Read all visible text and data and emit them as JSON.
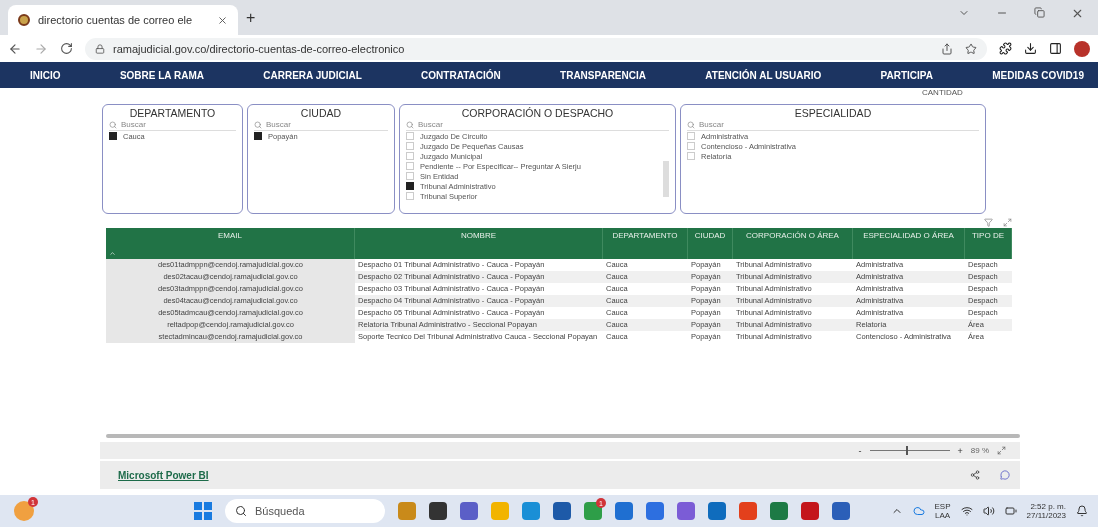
{
  "browser": {
    "tab_title": "directorio cuentas de correo ele",
    "new_tab": "+",
    "url": "ramajudicial.gov.co/directorio-cuentas-de-correo-electronico"
  },
  "nav": [
    "INICIO",
    "SOBRE LA RAMA",
    "CARRERA JUDICIAL",
    "CONTRATACIÓN",
    "TRANSPARENCIA",
    "ATENCIÓN AL USUARIO",
    "PARTICIPA",
    "MEDIDAS COVID19"
  ],
  "header_caption": "CANTIDAD",
  "slicers": [
    {
      "title": "DEPARTAMENTO",
      "placeholder": "Buscar",
      "items": [
        {
          "label": "Cauca",
          "checked": true
        }
      ]
    },
    {
      "title": "CIUDAD",
      "placeholder": "Buscar",
      "items": [
        {
          "label": "Popayán",
          "checked": true
        }
      ]
    },
    {
      "title": "CORPORACIÓN O DESPACHO",
      "placeholder": "Buscar",
      "items": [
        {
          "label": "Juzgado De Circuito",
          "checked": false
        },
        {
          "label": "Juzgado De Pequeñas Causas",
          "checked": false
        },
        {
          "label": "Juzgado Municipal",
          "checked": false
        },
        {
          "label": "Pendiente -- Por Especificar-- Preguntar A Sierju",
          "checked": false
        },
        {
          "label": "Sin Entidad",
          "checked": false
        },
        {
          "label": "Tribunal Administrativo",
          "checked": true
        },
        {
          "label": "Tribunal Superior",
          "checked": false
        }
      ]
    },
    {
      "title": "ESPECIALIDAD",
      "placeholder": "Buscar",
      "items": [
        {
          "label": "Administrativa",
          "checked": false
        },
        {
          "label": "Contencioso - Administrativa",
          "checked": false
        },
        {
          "label": "Relatoría",
          "checked": false
        }
      ]
    }
  ],
  "table": {
    "columns": [
      "EMAIL",
      "NOMBRE",
      "DEPARTAMENTO",
      "CIUDAD",
      "CORPORACIÓN O ÁREA",
      "ESPECIALIDAD O ÁREA",
      "TIPO DE"
    ],
    "rows": [
      [
        "des01tadmppn@cendoj.ramajudicial.gov.co",
        "Despacho 01 Tribunal Administrativo - Cauca - Popayán",
        "Cauca",
        "Popayán",
        "Tribunal Administrativo",
        "Administrativa",
        "Despach"
      ],
      [
        "des02tacau@cendoj.ramajudicial.gov.co",
        "Despacho 02 Tribunal Administrativo - Cauca - Popayán",
        "Cauca",
        "Popayán",
        "Tribunal Administrativo",
        "Administrativa",
        "Despach"
      ],
      [
        "des03tadmppn@cendoj.ramajudicial.gov.co",
        "Despacho 03 Tribunal Administrativo - Cauca - Popayán",
        "Cauca",
        "Popayán",
        "Tribunal Administrativo",
        "Administrativa",
        "Despach"
      ],
      [
        "des04tacau@cendoj.ramajudicial.gov.co",
        "Despacho 04 Tribunal Administrativo - Cauca - Popayán",
        "Cauca",
        "Popayán",
        "Tribunal Administrativo",
        "Administrativa",
        "Despach"
      ],
      [
        "des05tadmcau@cendoj.ramajudicial.gov.co",
        "Despacho 05 Tribunal Administrativo - Cauca - Popayán",
        "Cauca",
        "Popayán",
        "Tribunal Administrativo",
        "Administrativa",
        "Despach"
      ],
      [
        "reltadpop@cendoj.ramajudicial.gov.co",
        "Relatoría Tribunal Administrativo - Seccional Popayan",
        "Cauca",
        "Popayán",
        "Tribunal Administrativo",
        "Relatoría",
        "Área"
      ],
      [
        "stectadmincau@cendoj.ramajudicial.gov.co",
        "Soporte Tecnico Del Tribunal Administrativo Cauca - Seccional Popayan",
        "Cauca",
        "Popayán",
        "Tribunal Administrativo",
        "Contencioso - Administrativa",
        "Área"
      ]
    ]
  },
  "zoom": {
    "minus": "-",
    "plus": "+",
    "level": 0.45,
    "reading": "89 %"
  },
  "footer": {
    "link": "Microsoft Power BI"
  },
  "taskbar": {
    "weather_badge": "1",
    "search_placeholder": "Búsqueda",
    "apps": [
      {
        "color": "#c98a1a"
      },
      {
        "color": "#333333"
      },
      {
        "color": "#5b5fc7"
      },
      {
        "color": "#f2b400"
      },
      {
        "color": "#1a8fd6"
      },
      {
        "color": "#1e5aa8"
      },
      {
        "color": "#2e9e48",
        "badge": "1"
      },
      {
        "color": "#1f6fd1"
      },
      {
        "color": "#2d6fe0"
      },
      {
        "color": "#7b5cd6"
      },
      {
        "color": "#0f6cbd"
      },
      {
        "color": "#e3401c"
      },
      {
        "color": "#1d7a45"
      },
      {
        "color": "#c4161c"
      },
      {
        "color": "#2b5fb8"
      }
    ],
    "language": "ESP",
    "layout": "LAA",
    "time": "2:52 p. m.",
    "date": "27/11/2023"
  }
}
